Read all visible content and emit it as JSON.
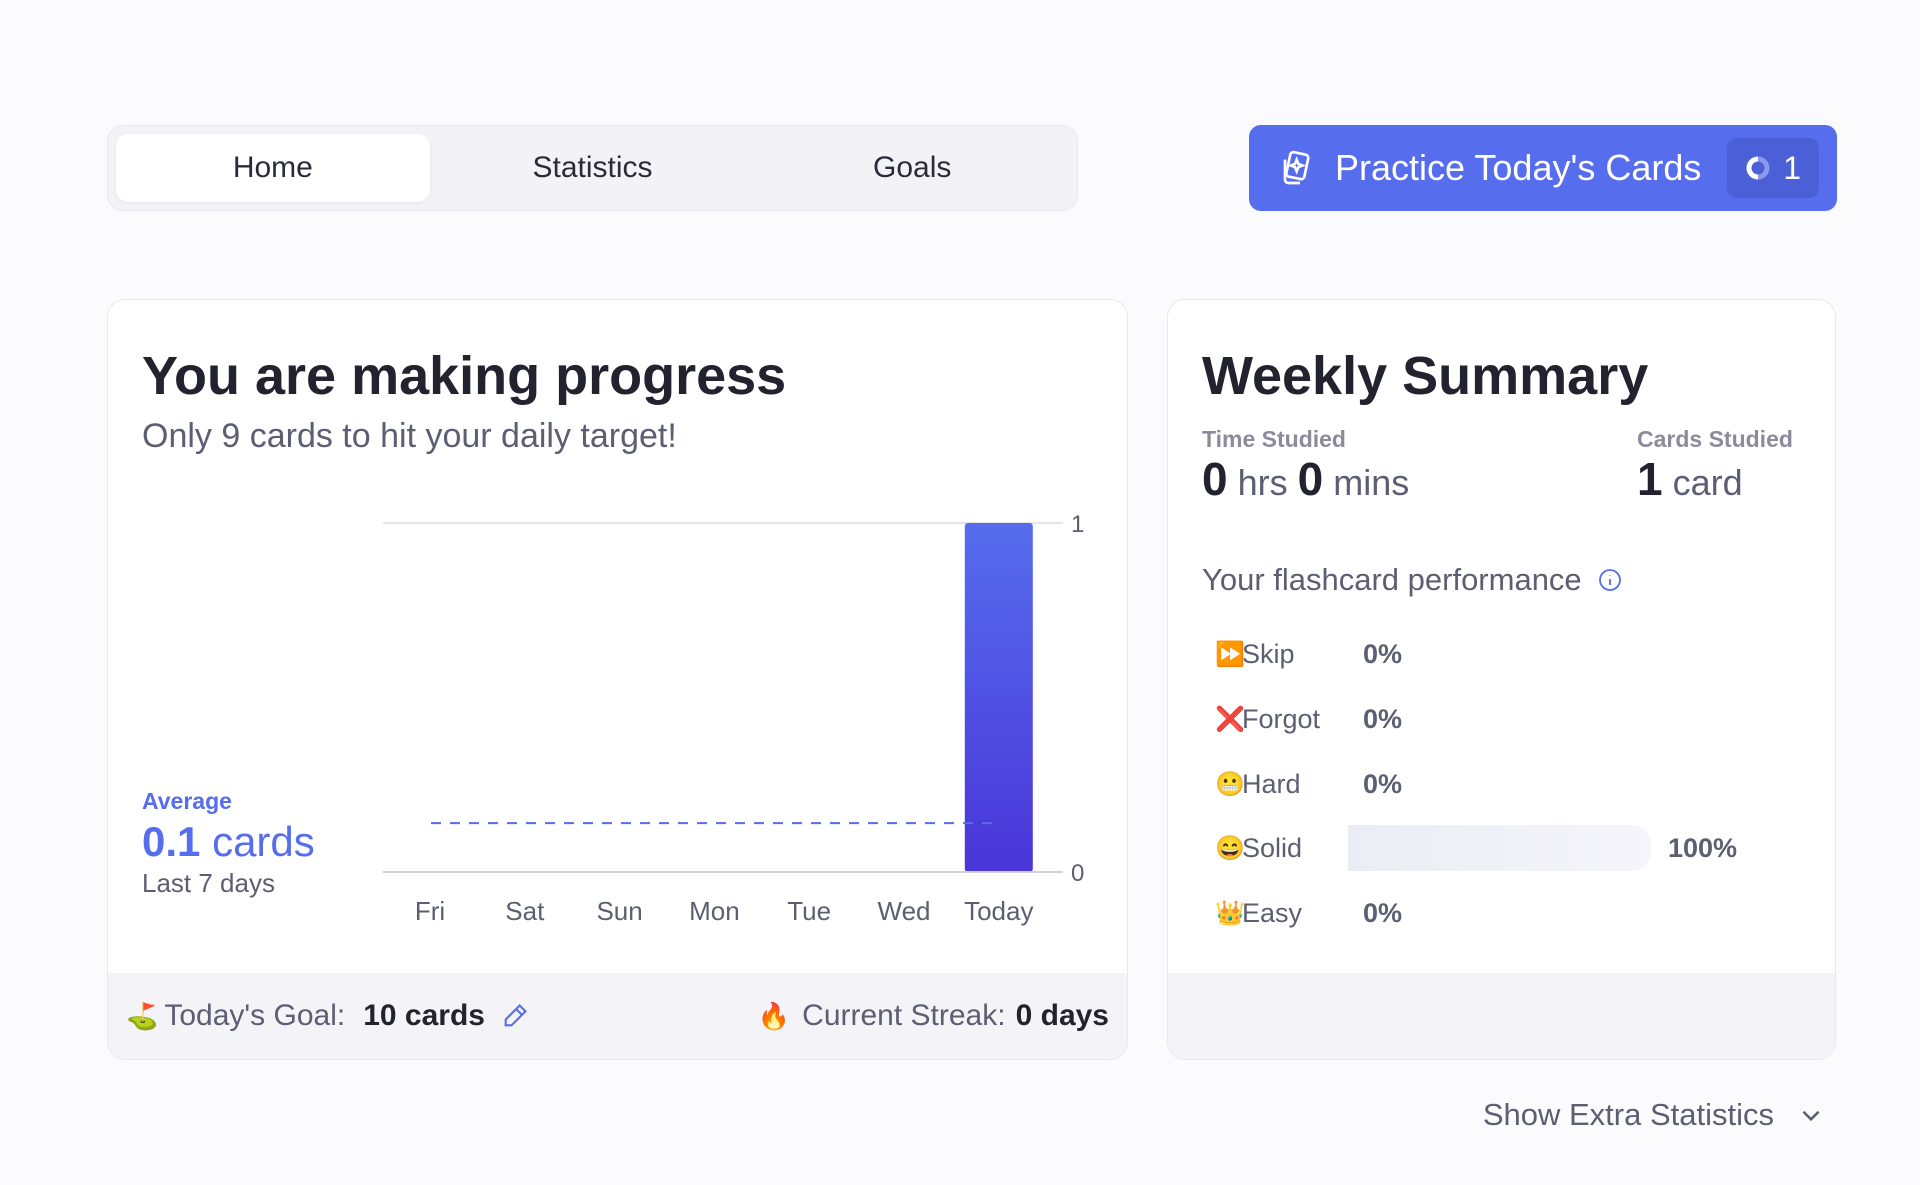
{
  "tabs": [
    {
      "label": "Home",
      "active": true
    },
    {
      "label": "Statistics"
    },
    {
      "label": "Goals"
    }
  ],
  "practice": {
    "label": "Practice Today's Cards",
    "count": "1",
    "icon": "cards-sparkle-icon",
    "color": "#566ded"
  },
  "progress": {
    "title": "You are making progress",
    "subtitle": "Only 9 cards to hit your daily target!",
    "average_label": "Average",
    "average_value": "0.1",
    "average_unit": "cards",
    "average_period": "Last 7 days"
  },
  "chart_data": {
    "type": "bar",
    "categories": [
      "Fri",
      "Sat",
      "Sun",
      "Mon",
      "Tue",
      "Wed",
      "Today"
    ],
    "values": [
      0,
      0,
      0,
      0,
      0,
      0,
      1
    ],
    "ylim": [
      0,
      1
    ],
    "yticks": [
      "0",
      "1"
    ],
    "average_line": 0.14,
    "bar_color": "#4f46e5",
    "grid": false
  },
  "footer": {
    "goal_label": "Today's Goal:",
    "goal_value": "10 cards",
    "streak_label": "Current Streak:",
    "streak_value": "0 days"
  },
  "weekly": {
    "title": "Weekly Summary",
    "time_label": "Time Studied",
    "hrs": "0",
    "hrs_unit": "hrs",
    "mins": "0",
    "mins_unit": "mins",
    "cards_label": "Cards Studied",
    "cards": "1",
    "cards_unit": "card",
    "perf_title": "Your flashcard performance",
    "rows": [
      {
        "icon": "⏩",
        "name": "Skip",
        "pct": "0%"
      },
      {
        "icon": "❌",
        "name": "Forgot",
        "pct": "0%"
      },
      {
        "icon": "😬",
        "name": "Hard",
        "pct": "0%"
      },
      {
        "icon": "😄",
        "name": "Solid",
        "pct": "100%",
        "fill": 1
      },
      {
        "icon": "👑",
        "name": "Easy",
        "pct": "0%"
      }
    ]
  },
  "extra": {
    "label": "Show Extra Statistics"
  }
}
